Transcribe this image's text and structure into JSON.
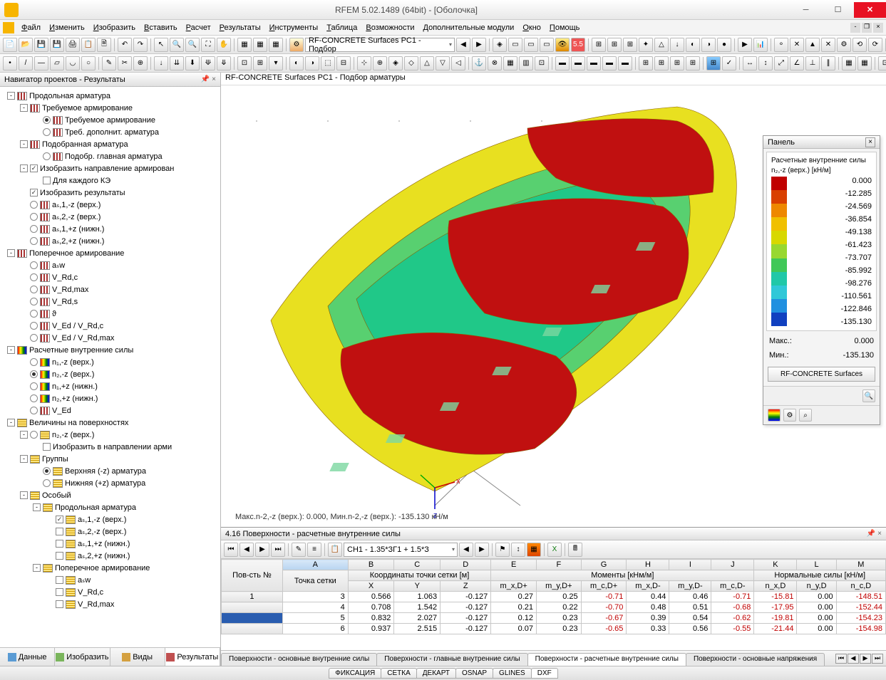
{
  "window": {
    "title": "RFEM 5.02.1489 (64bit) - [Оболочка]"
  },
  "menu": [
    "Файл",
    "Изменить",
    "Изобразить",
    "Вставить",
    "Расчет",
    "Результаты",
    "Инструменты",
    "Таблица",
    "Возможности",
    "Дополнительные модули",
    "Окно",
    "Помощь"
  ],
  "toolbar1_combo": "RF-CONCRETE Surfaces PC1 - Подбор",
  "nav": {
    "title": "Навигатор проектов - Результаты",
    "tabs": [
      "Данные",
      "Изобразить",
      "Виды",
      "Результаты"
    ],
    "tree": [
      {
        "lvl": 0,
        "tg": "-",
        "ic": "bars",
        "txt": "Продольная арматура"
      },
      {
        "lvl": 1,
        "tg": "-",
        "ic": "bars",
        "txt": "Требуемое армирование"
      },
      {
        "lvl": 2,
        "rb": "on",
        "ic": "bars",
        "txt": "Требуемое армирование"
      },
      {
        "lvl": 2,
        "rb": "",
        "ic": "bars",
        "txt": "Треб. дополнит. арматура"
      },
      {
        "lvl": 1,
        "tg": "-",
        "ic": "bars",
        "txt": "Подобранная арматура"
      },
      {
        "lvl": 2,
        "rb": "",
        "ic": "bars",
        "txt": "Подобр. главная арматура"
      },
      {
        "lvl": 1,
        "tg": "-",
        "cb": "on",
        "txt": "Изобразить направление армирован"
      },
      {
        "lvl": 2,
        "cb": "",
        "txt": "Для каждого КЭ"
      },
      {
        "lvl": 1,
        "cb": "on",
        "txt": "Изобразить результаты"
      },
      {
        "lvl": 1,
        "rb": "",
        "ic": "bars",
        "txt": "aₛ,1,-z (верх.)"
      },
      {
        "lvl": 1,
        "rb": "",
        "ic": "bars",
        "txt": "aₛ,2,-z (верх.)"
      },
      {
        "lvl": 1,
        "rb": "",
        "ic": "bars",
        "txt": "aₛ,1,+z (нижн.)"
      },
      {
        "lvl": 1,
        "rb": "",
        "ic": "bars",
        "txt": "aₛ,2,+z (нижн.)"
      },
      {
        "lvl": 0,
        "tg": "-",
        "ic": "bars",
        "txt": "Поперечное армирование"
      },
      {
        "lvl": 1,
        "rb": "",
        "ic": "bars",
        "txt": "aₛw"
      },
      {
        "lvl": 1,
        "rb": "",
        "ic": "bars",
        "txt": "V_Rd,c"
      },
      {
        "lvl": 1,
        "rb": "",
        "ic": "bars",
        "txt": "V_Rd,max"
      },
      {
        "lvl": 1,
        "rb": "",
        "ic": "bars",
        "txt": "V_Rd,s"
      },
      {
        "lvl": 1,
        "rb": "",
        "ic": "bars",
        "txt": "ϑ"
      },
      {
        "lvl": 1,
        "rb": "",
        "ic": "bars",
        "txt": "V_Ed / V_Rd,c"
      },
      {
        "lvl": 1,
        "rb": "",
        "ic": "bars",
        "txt": "V_Ed / V_Rd,max"
      },
      {
        "lvl": 0,
        "tg": "-",
        "ic": "heat",
        "txt": "Расчетные внутренние силы"
      },
      {
        "lvl": 1,
        "rb": "",
        "ic": "heat",
        "txt": "n₁,-z (верх.)"
      },
      {
        "lvl": 1,
        "rb": "on",
        "ic": "heat",
        "txt": "n₂,-z (верх.)"
      },
      {
        "lvl": 1,
        "rb": "",
        "ic": "heat",
        "txt": "n₁,+z (нижн.)"
      },
      {
        "lvl": 1,
        "rb": "",
        "ic": "heat",
        "txt": "n₂,+z (нижн.)"
      },
      {
        "lvl": 1,
        "rb": "",
        "ic": "bars",
        "txt": "V_Ed"
      },
      {
        "lvl": 0,
        "tg": "-",
        "ic": "grid",
        "txt": "Величины на поверхностях"
      },
      {
        "lvl": 1,
        "tg": "-",
        "rb": "",
        "ic": "grid",
        "txt": "n₂,-z (верх.)"
      },
      {
        "lvl": 2,
        "cb": "",
        "txt": "Изобразить в направлении арми"
      },
      {
        "lvl": 1,
        "tg": "-",
        "ic": "grid",
        "txt": "Группы"
      },
      {
        "lvl": 2,
        "rb": "on",
        "ic": "grid",
        "txt": "Верхняя (-z) арматура"
      },
      {
        "lvl": 2,
        "rb": "",
        "ic": "grid",
        "txt": "Нижняя (+z) арматура"
      },
      {
        "lvl": 1,
        "tg": "-",
        "ic": "grid",
        "txt": "Особый"
      },
      {
        "lvl": 2,
        "tg": "-",
        "ic": "grid",
        "txt": "Продольная арматура"
      },
      {
        "lvl": 3,
        "cb": "on",
        "ic": "grid",
        "txt": "aₛ,1,-z (верх.)"
      },
      {
        "lvl": 3,
        "cb": "",
        "ic": "grid",
        "txt": "aₛ,2,-z (верх.)"
      },
      {
        "lvl": 3,
        "cb": "",
        "ic": "grid",
        "txt": "aₛ,1,+z (нижн.)"
      },
      {
        "lvl": 3,
        "cb": "",
        "ic": "grid",
        "txt": "aₛ,2,+z (нижн.)"
      },
      {
        "lvl": 2,
        "tg": "-",
        "ic": "grid",
        "txt": "Поперечное армирование"
      },
      {
        "lvl": 3,
        "cb": "",
        "ic": "grid",
        "txt": "aₛw"
      },
      {
        "lvl": 3,
        "cb": "",
        "ic": "grid",
        "txt": "V_Rd,c"
      },
      {
        "lvl": 3,
        "cb": "",
        "ic": "grid",
        "txt": "V_Rd,max"
      }
    ]
  },
  "view": {
    "header": "RF-CONCRETE Surfaces PC1 - Подбор арматуры",
    "caption": "Макс.n-2,-z (верх.): 0.000, Мин.n-2,-z (верх.): -135.130 кН/м"
  },
  "panel": {
    "title": "Панель",
    "subtitle": "Расчетные внутренние силы",
    "quantity": "n₂,-z (верх.) [кН/м]",
    "colors": [
      "#c00000",
      "#d94000",
      "#ee8800",
      "#f0c000",
      "#d8d800",
      "#98d830",
      "#40c858",
      "#20c8a8",
      "#30c8d8",
      "#2090e0",
      "#1040c0"
    ],
    "values": [
      "0.000",
      "-12.285",
      "-24.569",
      "-36.854",
      "-49.138",
      "-61.423",
      "-73.707",
      "-85.992",
      "-98.276",
      "-110.561",
      "-122.846",
      "-135.130"
    ],
    "max_lbl": "Макс.:",
    "max": "0.000",
    "min_lbl": "Мин.:",
    "min": "-135.130",
    "button": "RF-CONCRETE Surfaces"
  },
  "table": {
    "title": "4.16 Поверхности - расчетные внутренние силы",
    "combo": "CH1 - 1.35*ЗГ1 + 1.5*З",
    "letters": [
      "A",
      "B",
      "C",
      "D",
      "E",
      "F",
      "G",
      "H",
      "I",
      "J",
      "K",
      "L",
      "M"
    ],
    "group1": "Координаты точки сетки [м]",
    "group2": "Моменты [кНм/м]",
    "group3": "Нормальные силы [кН/м]",
    "hdr_row": [
      "Пов-сть №",
      "Точка сетки",
      "X",
      "Y",
      "Z",
      "m_x,D+",
      "m_y,D+",
      "m_c,D+",
      "m_x,D-",
      "m_y,D-",
      "m_c,D-",
      "n_x,D",
      "n_y,D",
      "n_c,D"
    ],
    "rows": [
      {
        "surf": "1",
        "pt": "3",
        "x": "0.566",
        "y": "1.063",
        "z": "-0.127",
        "mxp": "0.27",
        "myp": "0.25",
        "mcp": "-0.71",
        "mxn": "0.44",
        "myn": "0.46",
        "mcn": "-0.71",
        "nx": "-15.81",
        "ny": "0.00",
        "nc": "-148.51"
      },
      {
        "surf": "",
        "pt": "4",
        "x": "0.708",
        "y": "1.542",
        "z": "-0.127",
        "mxp": "0.21",
        "myp": "0.22",
        "mcp": "-0.70",
        "mxn": "0.48",
        "myn": "0.51",
        "mcn": "-0.68",
        "nx": "-17.95",
        "ny": "0.00",
        "nc": "-152.44"
      },
      {
        "surf": "",
        "pt": "5",
        "x": "0.832",
        "y": "2.027",
        "z": "-0.127",
        "mxp": "0.12",
        "myp": "0.23",
        "mcp": "-0.67",
        "mxn": "0.39",
        "myn": "0.54",
        "mcn": "-0.62",
        "nx": "-19.81",
        "ny": "0.00",
        "nc": "-154.23"
      },
      {
        "surf": "",
        "pt": "6",
        "x": "0.937",
        "y": "2.515",
        "z": "-0.127",
        "mxp": "0.07",
        "myp": "0.23",
        "mcp": "-0.65",
        "mxn": "0.33",
        "myn": "0.56",
        "mcn": "-0.55",
        "nx": "-21.44",
        "ny": "0.00",
        "nc": "-154.98"
      }
    ],
    "tabs": [
      "Поверхности - основные внутренние силы",
      "Поверхности - главные внутренние силы",
      "Поверхности - расчетные внутренние силы",
      "Поверхности - основные напряжения"
    ]
  },
  "status": [
    "ФИКСАЦИЯ",
    "СЕТКА",
    "ДЕКАРТ",
    "OSNAP",
    "GLINES",
    "DXF"
  ]
}
